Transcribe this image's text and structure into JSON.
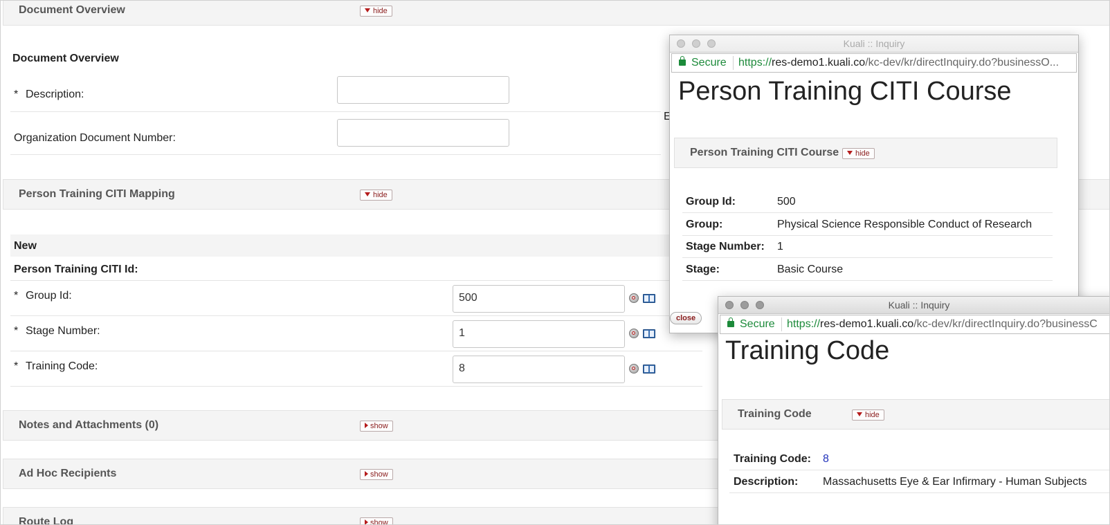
{
  "main": {
    "sections": {
      "doc_overview_bar": {
        "title": "Document Overview",
        "toggle": "hide"
      },
      "citi_mapping_bar": {
        "title": "Person Training CITI Mapping",
        "toggle": "hide"
      },
      "notes_bar": {
        "title": "Notes and Attachments (0)",
        "toggle": "show"
      },
      "adhoc_bar": {
        "title": "Ad Hoc Recipients",
        "toggle": "show"
      },
      "routelog_bar": {
        "title": "Route Log",
        "toggle": "show"
      }
    },
    "doc_overview": {
      "heading": "Document Overview",
      "description_label": "Description:",
      "org_doc_number_label": "Organization Document Number:",
      "partial_text": "E"
    },
    "citi_mapping": {
      "new_label": "New",
      "id_label": "Person Training CITI Id:",
      "group_id_label": "Group Id:",
      "group_id_value": "500",
      "stage_number_label": "Stage Number:",
      "stage_number_value": "1",
      "training_code_label": "Training Code:",
      "training_code_value": "8"
    },
    "required_marker": "*"
  },
  "popup1": {
    "window_title": "Kuali :: Inquiry",
    "secure_label": "Secure",
    "url_scheme": "https://",
    "url_host": "res-demo1.kuali.co",
    "url_path": "/kc-dev/kr/directInquiry.do?businessO...",
    "heading": "Person Training CITI Course",
    "panel_title": "Person Training CITI Course",
    "panel_toggle": "hide",
    "fields": [
      {
        "label": "Group Id:",
        "value": "500"
      },
      {
        "label": "Group:",
        "value": "Physical Science Responsible Conduct of Research"
      },
      {
        "label": "Stage Number:",
        "value": "1"
      },
      {
        "label": "Stage:",
        "value": "Basic Course"
      }
    ],
    "close_label": "close"
  },
  "popup2": {
    "window_title": "Kuali :: Inquiry",
    "secure_label": "Secure",
    "url_scheme": "https://",
    "url_host": "res-demo1.kuali.co",
    "url_path": "/kc-dev/kr/directInquiry.do?businessC",
    "heading": "Training Code",
    "panel_title": "Training Code",
    "panel_toggle": "hide",
    "fields": [
      {
        "label": "Training Code:",
        "value": "8"
      },
      {
        "label": "Description:",
        "value": "Massachusetts Eye & Ear Infirmary - Human Subjects"
      }
    ]
  },
  "colors": {
    "toggle_text": "#8a1c1c",
    "secure_green": "#1c8a3a",
    "link_blue": "#2233bb",
    "panel_bg": "#f4f4f4"
  },
  "icons": [
    "lookup-icon",
    "book-icon",
    "lock-icon",
    "triangle-down-icon",
    "triangle-right-icon"
  ]
}
